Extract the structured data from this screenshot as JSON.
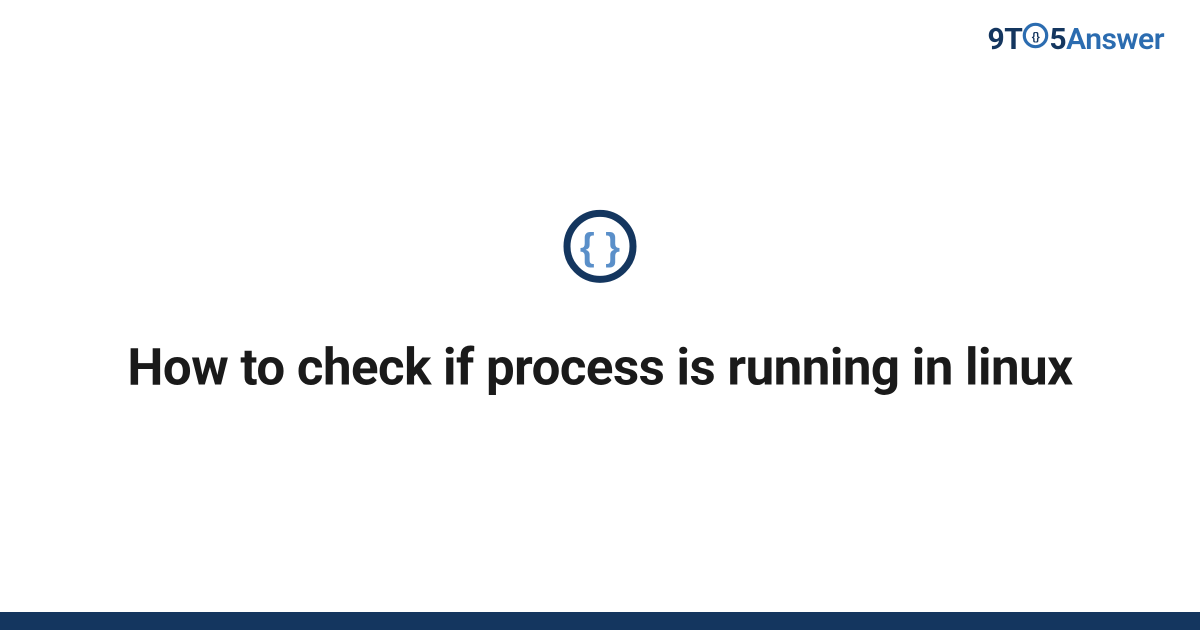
{
  "logo": {
    "part1": "9T",
    "part2": "5",
    "part3": "Answer"
  },
  "title": "How to check if process is running in linux",
  "icon_name": "code-braces-icon",
  "colors": {
    "brand_dark": "#14365f",
    "brand_mid": "#2b6cb0",
    "braces_outer": "#14365f",
    "braces_inner": "#5a8fc9"
  }
}
